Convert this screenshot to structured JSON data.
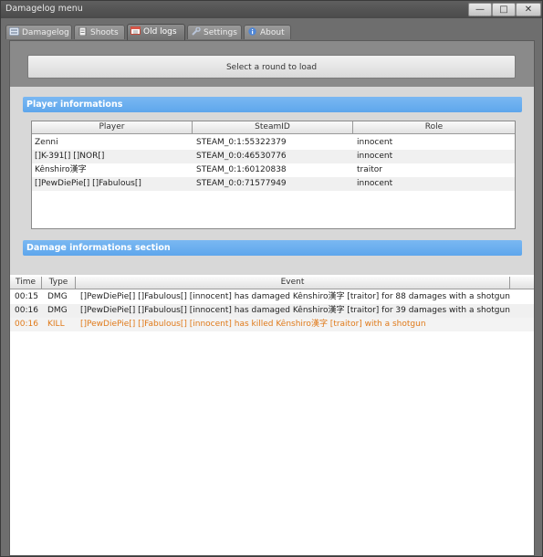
{
  "window": {
    "title": "Damagelog menu",
    "min_glyph": "—",
    "max_glyph": "□",
    "close_glyph": "✕"
  },
  "tabs": [
    {
      "label": "Damagelog",
      "icon": "list-icon"
    },
    {
      "label": "Shoots",
      "icon": "document-icon"
    },
    {
      "label": "Old logs",
      "icon": "calendar-icon",
      "active": true
    },
    {
      "label": "Settings",
      "icon": "wrench-icon"
    },
    {
      "label": "About",
      "icon": "info-icon"
    }
  ],
  "load_button": "Select a round to load",
  "player_section": {
    "title": "Player informations",
    "columns": [
      "Player",
      "SteamID",
      "Role"
    ],
    "rows": [
      {
        "player": "Zenni",
        "steamid": "STEAM_0:1:55322379",
        "role": "innocent"
      },
      {
        "player": "[]K-391[] []NOR[]",
        "steamid": "STEAM_0:0:46530776",
        "role": "innocent"
      },
      {
        "player": "Kênshiro漢字",
        "steamid": "STEAM_0:1:60120838",
        "role": "traitor"
      },
      {
        "player": "[]PewDiePie[] []Fabulous[]",
        "steamid": "STEAM_0:0:71577949",
        "role": "innocent"
      }
    ]
  },
  "damage_section": {
    "title": "Damage informations section",
    "columns": [
      "Time",
      "Type",
      "Event"
    ],
    "rows": [
      {
        "time": "00:15",
        "type": "DMG",
        "event": "[]PewDiePie[] []Fabulous[] [innocent] has damaged Kênshiro漢字 [traitor] for 88 damages with a shotgun"
      },
      {
        "time": "00:16",
        "type": "DMG",
        "event": "[]PewDiePie[] []Fabulous[] [innocent] has damaged Kênshiro漢字 [traitor] for 39 damages with a shotgun"
      },
      {
        "time": "00:16",
        "type": "KILL",
        "event": "[]PewDiePie[] []Fabulous[] [innocent] has killed Kênshiro漢字 [traitor] with a shotgun"
      }
    ]
  },
  "colors": {
    "section_bar": "#6aaeef",
    "kill_text": "#e07a1a"
  }
}
